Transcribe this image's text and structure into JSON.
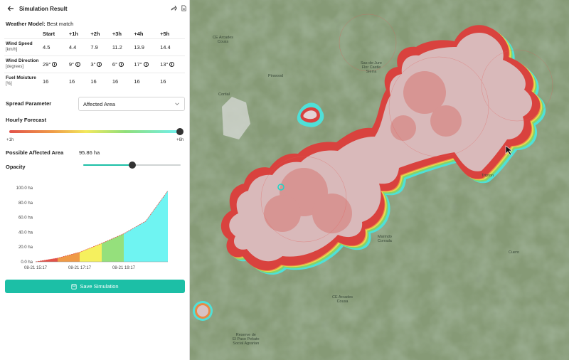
{
  "header": {
    "title": "Simulation Result"
  },
  "weather_model": {
    "label": "Weather Model:",
    "value": "Best match"
  },
  "table": {
    "columns": [
      "Start",
      "+1h",
      "+2h",
      "+3h",
      "+4h",
      "+5h"
    ],
    "rows": [
      {
        "label": "Wind Speed",
        "unit": "[km/h]",
        "values": [
          "4.5",
          "4.4",
          "7.9",
          "11.2",
          "13.9",
          "14.4"
        ]
      },
      {
        "label": "Wind Direction",
        "unit": "[degrees]",
        "values": [
          "29°",
          "9°",
          "3°",
          "6°",
          "17°",
          "13°"
        ]
      },
      {
        "label": "Fuel Moisture",
        "unit": "[%]",
        "values": [
          "16",
          "16",
          "16",
          "16",
          "16",
          "16"
        ]
      }
    ]
  },
  "spread_parameter": {
    "label": "Spread Parameter",
    "value": "Affected Area"
  },
  "hourly_forecast": {
    "label": "Hourly Forecast",
    "start_label": "+1h",
    "end_label": "+6h",
    "selected_fraction": 1.0
  },
  "affected_area": {
    "label": "Possible Affected Area",
    "value": "95.86 ha"
  },
  "opacity": {
    "label": "Opacity",
    "fraction": 0.5
  },
  "save_label": "Save Simulation",
  "map_labels": [
    "CE Arcades\nCouss",
    "Pinwood",
    "Sas-de-Jure\nFlor Castle\nSierra",
    "Cortial",
    "Tripton",
    "Marindo\nCorrada",
    "CE Arcades\nCousa",
    "Reserve de\nEl Paso Pekato\nSocial Agrarian",
    "Cuero"
  ],
  "chart_data": {
    "type": "area",
    "x_tick_labels": [
      "08-21 15:17",
      "08-21 17:17",
      "08-21 19:17"
    ],
    "y_tick_labels": [
      "0.0 ha",
      "20.0 ha",
      "40.0 ha",
      "60.0 ha",
      "80.0 ha",
      "100.0 ha"
    ],
    "ylim": [
      0,
      100
    ],
    "x_hours": [
      0,
      1,
      2,
      3,
      4,
      5,
      6
    ],
    "values": [
      0,
      5,
      13,
      25,
      38,
      55,
      96
    ],
    "band_colors": [
      "#e2524a",
      "#ef9a47",
      "#f5f05e",
      "#95e07c",
      "#6ff4f2",
      "#6ff4f2"
    ],
    "line_color": "#e2524a"
  },
  "colors": {
    "accent": "#1cbfa6"
  }
}
